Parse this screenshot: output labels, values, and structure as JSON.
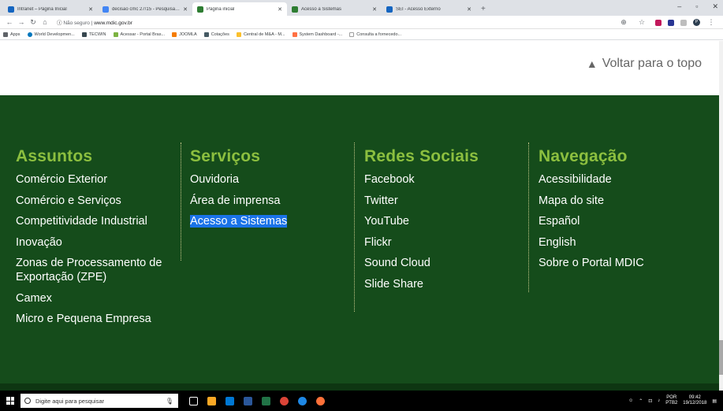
{
  "browser": {
    "tabs": [
      {
        "label": "Intranet – Página Inicial",
        "color": "#1565c0"
      },
      {
        "label": "decisão cmc 27/15 - Pesquisa G...",
        "color": "#4285f4"
      },
      {
        "label": "Página inicial",
        "color": "#2e7d32",
        "active": true
      },
      {
        "label": "Acesso a Sistemas",
        "color": "#2e7d32"
      },
      {
        "label": "SEI - Acesso Externo",
        "color": "#1565c0"
      }
    ],
    "new_tab": "+",
    "controls": {
      "minimize": "–",
      "maximize": "▫",
      "close": "✕"
    },
    "url_not_secure": "Não seguro",
    "url": "www.mdic.gov.br",
    "bookmarks": [
      {
        "label": "Apps",
        "color": "#5f6368"
      },
      {
        "label": "World Developmen...",
        "color": "#0277bd"
      },
      {
        "label": "TECWIN",
        "color": "#37474f"
      },
      {
        "label": "Acessar - Portal Bras...",
        "color": "#7cb342"
      },
      {
        "label": "JOOMLA",
        "color": "#f57c00"
      },
      {
        "label": "Cotações",
        "color": "#455a64"
      },
      {
        "label": "Central de M&A - M...",
        "color": "#fbc02d"
      },
      {
        "label": "System Dashboard -...",
        "color": "#ff7043"
      },
      {
        "label": "Consulta a fornecedo...",
        "color": "#9e9e9e"
      }
    ],
    "profile_initial": "P"
  },
  "page": {
    "back_to_top": "Voltar para o topo",
    "columns": [
      {
        "title": "Assuntos",
        "items": [
          "Comércio Exterior",
          "Comércio e Serviços",
          "Competitividade Industrial",
          "Inovação",
          "Zonas de Processamento de Exportação (ZPE)",
          "Camex",
          "Micro e Pequena Empresa"
        ]
      },
      {
        "title": "Serviços",
        "items": [
          "Ouvidoria",
          "Área de imprensa",
          "Acesso a Sistemas"
        ]
      },
      {
        "title": "Redes Sociais",
        "items": [
          "Facebook",
          "Twitter",
          "YouTube",
          "Flickr",
          "Sound Cloud",
          "Slide Share"
        ]
      },
      {
        "title": "Navegação",
        "items": [
          "Acessibilidade",
          "Mapa do site",
          "Español",
          "English",
          "Sobre o Portal MDIC"
        ]
      }
    ]
  },
  "taskbar": {
    "search_placeholder": "Digite aqui para pesquisar",
    "lang_top": "POR",
    "lang_bottom": "PTB2",
    "time": "09:42",
    "date": "19/12/2018"
  }
}
